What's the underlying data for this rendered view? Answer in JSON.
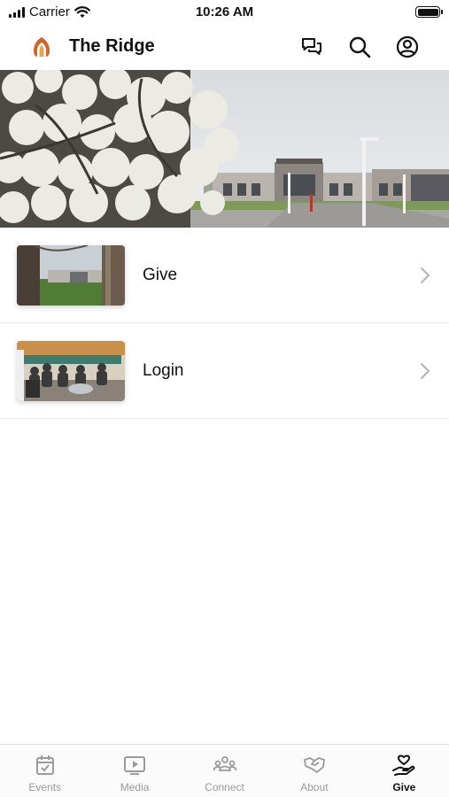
{
  "status_bar": {
    "carrier": "Carrier",
    "time": "10:26 AM"
  },
  "header": {
    "title": "The Ridge",
    "logo_colors": [
      "#d0662a",
      "#e9a449"
    ],
    "icons": [
      "chat-icon",
      "search-icon",
      "account-icon"
    ]
  },
  "hero": {
    "image": "blossoming-tree-and-church-building-photo"
  },
  "list": {
    "items": [
      {
        "label": "Give",
        "thumbnail": "church-building-lawn-photo",
        "chevron": "chevron-right-icon"
      },
      {
        "label": "Login",
        "thumbnail": "people-sitting-lobby-photo",
        "chevron": "chevron-right-icon"
      }
    ]
  },
  "tab_bar": {
    "active": "Give",
    "tabs": [
      {
        "label": "Events",
        "icon": "calendar-icon"
      },
      {
        "label": "Media",
        "icon": "play-screen-icon"
      },
      {
        "label": "Connect",
        "icon": "people-group-icon"
      },
      {
        "label": "About",
        "icon": "handshake-icon"
      },
      {
        "label": "Give",
        "icon": "heart-hand-icon"
      }
    ]
  },
  "colors": {
    "text": "#111111",
    "tab_inactive": "#9a9a9a",
    "divider": "#e8e8e8"
  }
}
